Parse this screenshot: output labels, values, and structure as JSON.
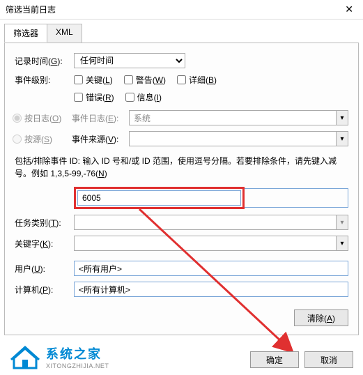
{
  "window": {
    "title": "筛选当前日志"
  },
  "tabs": {
    "filter": "筛选器",
    "xml": "XML"
  },
  "form": {
    "logged": {
      "label_pre": "记录时间(",
      "hot": "G",
      "label_post": "):",
      "value": "任何时间"
    },
    "level": {
      "label": "事件级别:",
      "critical_pre": "关键(",
      "critical_hot": "L",
      "critical_post": ")",
      "warning_pre": "警告(",
      "warning_hot": "W",
      "warning_post": ")",
      "verbose_pre": "详细(",
      "verbose_hot": "B",
      "verbose_post": ")",
      "error_pre": "错误(",
      "error_hot": "R",
      "error_post": ")",
      "info_pre": "信息(",
      "info_hot": "I",
      "info_post": ")"
    },
    "bylog": {
      "label_pre": "按日志(",
      "hot": "O",
      "label_post": ")",
      "eventlog_pre": "事件日志(",
      "eventlog_hot": "E",
      "eventlog_post": "):",
      "value": "系统"
    },
    "bysource": {
      "label_pre": "按源(",
      "hot": "S",
      "label_post": ")",
      "src_pre": "事件来源(",
      "src_hot": "V",
      "src_post": "):",
      "value": ""
    },
    "help_pre": "包括/排除事件 ID: 输入 ID 号和/或 ID 范围，使用逗号分隔。若要排除条件，请先键入减号。例如 1,3,5-99,-76(",
    "help_hot": "N",
    "help_post": ")",
    "eventid_value": "6005",
    "taskcat": {
      "label_pre": "任务类别(",
      "hot": "T",
      "label_post": "):",
      "value": ""
    },
    "keywords": {
      "label_pre": "关键字(",
      "hot": "K",
      "label_post": "):",
      "value": ""
    },
    "user": {
      "label_pre": "用户(",
      "hot": "U",
      "label_post": "):",
      "value": "<所有用户>"
    },
    "computer": {
      "label_pre": "计算机(",
      "hot": "P",
      "label_post": "):",
      "value": "<所有计算机>"
    },
    "clear_pre": "清除(",
    "clear_hot": "A",
    "clear_post": ")"
  },
  "logo": {
    "name": "系统之家",
    "url": "XITONGZHIJIA.NET"
  },
  "buttons": {
    "ok": "确定",
    "cancel": "取消"
  }
}
